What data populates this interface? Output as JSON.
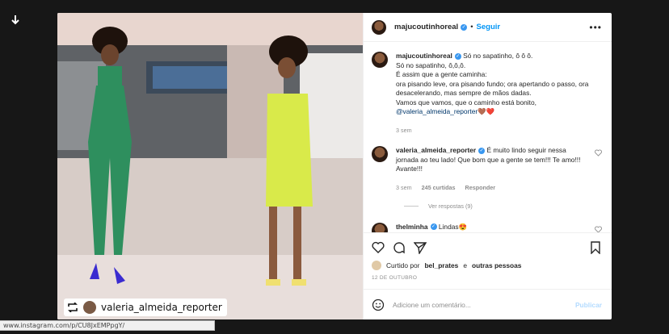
{
  "colors": {
    "accent": "#0095f6",
    "verified": "#3897f0",
    "muted": "#8e8e8e"
  },
  "post": {
    "username": "majucoutinhoreal",
    "follow_label": "Seguir",
    "caption_lines": [
      "Só no sapatinho, ô ô ô.",
      "Só no sapatinho, ô,ô,ô.",
      "É assim que a gente caminha:",
      "ora pisando leve, ora pisando fundo; ora apertando o passo, ora desacelerando, mas sempre de mãos dadas.",
      "Vamos que vamos, que o caminho está bonito,"
    ],
    "caption_mention": "@valeria_almeida_reporter",
    "caption_emoji": "🤎❤️",
    "caption_time": "3 sem",
    "repost_name": "valeria_almeida_reporter"
  },
  "comments": [
    {
      "username": "valeria_almeida_reporter",
      "text": "É muito lindo seguir nessa jornada ao teu lado! Que bom que a gente se tem!!! Te amo!!! Avante!!!",
      "time": "3 sem",
      "likes": "245 curtidas",
      "reply": "Responder",
      "view_replies": "Ver respostas (9)"
    },
    {
      "username": "thelminha",
      "text": "Lindas😍"
    }
  ],
  "likes": {
    "prefix": "Curtido por",
    "user": "bel_prates",
    "connector": "e",
    "others": "outras pessoas"
  },
  "date": "12 DE OUTUBRO",
  "add_comment": {
    "placeholder": "Adicione um comentário...",
    "post_label": "Publicar"
  },
  "status_url": "www.instagram.com/p/CU8JxEMPpgY/",
  "icons": [
    "download-icon",
    "more-icon",
    "heart-icon",
    "comment-icon",
    "share-icon",
    "save-icon",
    "emoji-icon",
    "repost-icon"
  ]
}
